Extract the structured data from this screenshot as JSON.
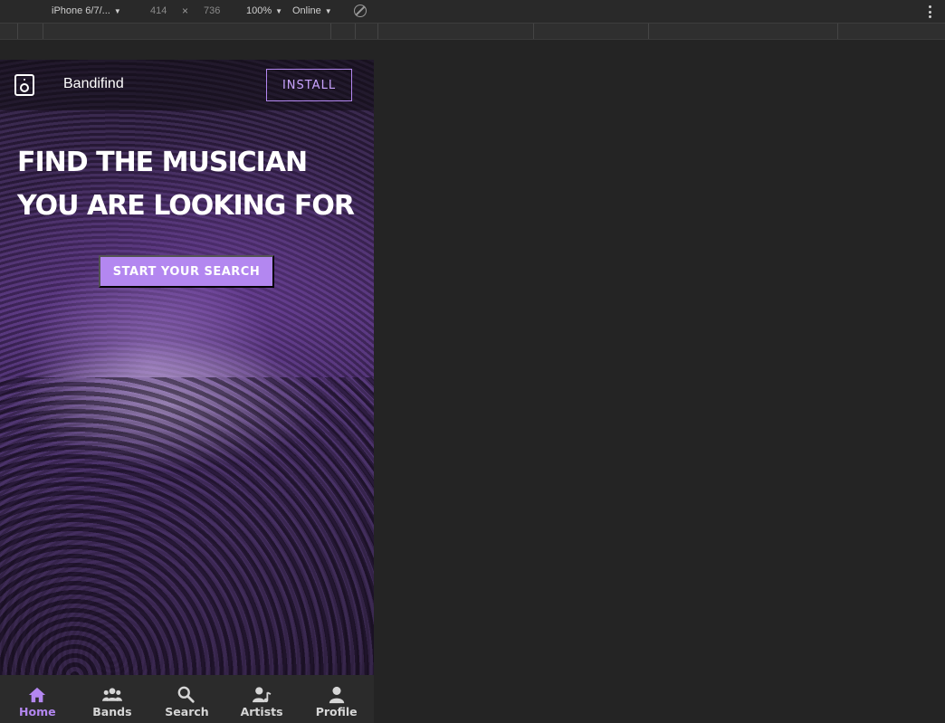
{
  "devtools": {
    "device": "iPhone 6/7/...",
    "width": "414",
    "times": "×",
    "height": "736",
    "zoom": "100%",
    "network": "Online",
    "caret": "▼"
  },
  "app": {
    "brand": "Bandifind",
    "install_label": "INSTALL",
    "headline": [
      "FIND THE MUSICIAN",
      "YOU ARE LOOKING FOR"
    ],
    "cta_label": "START YOUR SEARCH",
    "accent": "#b387f0"
  },
  "nav": {
    "items": [
      {
        "label": "Home",
        "icon": "home-icon",
        "active": true
      },
      {
        "label": "Bands",
        "icon": "group-icon",
        "active": false
      },
      {
        "label": "Search",
        "icon": "search-icon",
        "active": false
      },
      {
        "label": "Artists",
        "icon": "artist-icon",
        "active": false
      },
      {
        "label": "Profile",
        "icon": "person-icon",
        "active": false
      }
    ]
  }
}
